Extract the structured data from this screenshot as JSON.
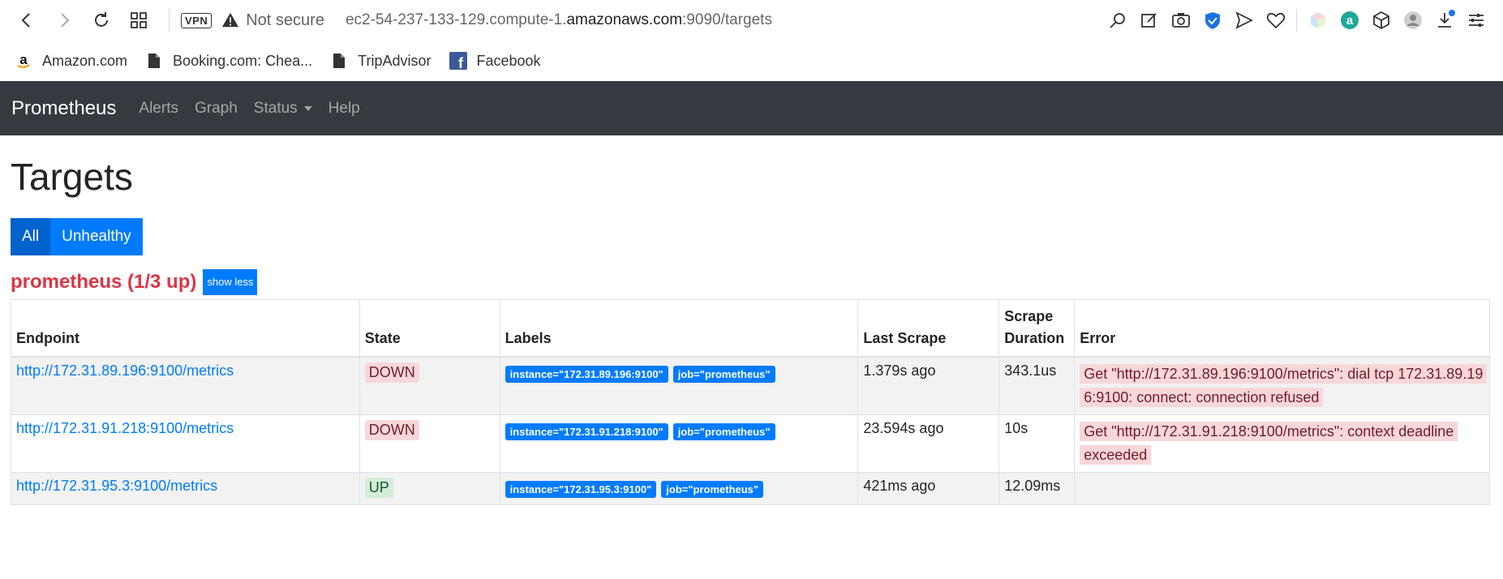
{
  "browser": {
    "vpn_label": "VPN",
    "security_text": "Not secure",
    "url_prefix": "ec2-54-237-133-129.compute-1.",
    "url_domain": "amazonaws.com",
    "url_suffix": ":9090/targets"
  },
  "bookmarks": [
    {
      "label": "Amazon.com",
      "icon": "amazon-icon"
    },
    {
      "label": "Booking.com: Chea...",
      "icon": "page-icon"
    },
    {
      "label": "TripAdvisor",
      "icon": "page-icon"
    },
    {
      "label": "Facebook",
      "icon": "facebook-icon"
    }
  ],
  "navbar": {
    "brand": "Prometheus",
    "links": [
      "Alerts",
      "Graph",
      "Status",
      "Help"
    ]
  },
  "page": {
    "title": "Targets",
    "filter_all": "All",
    "filter_unhealthy": "Unhealthy",
    "job_title": "prometheus (1/3 up)",
    "show_less": "show less"
  },
  "table": {
    "headers": [
      "Endpoint",
      "State",
      "Labels",
      "Last Scrape",
      "Scrape Duration",
      "Error"
    ],
    "rows": [
      {
        "endpoint": "http://172.31.89.196:9100/metrics",
        "state": "DOWN",
        "label_instance": "instance=\"172.31.89.196:9100\"",
        "label_job": "job=\"prometheus\"",
        "last_scrape": "1.379s ago",
        "duration": "343.1us",
        "error": "Get \"http://172.31.89.196:9100/metrics\": dial tcp 172.31.89.196:9100: connect: connection refused"
      },
      {
        "endpoint": "http://172.31.91.218:9100/metrics",
        "state": "DOWN",
        "label_instance": "instance=\"172.31.91.218:9100\"",
        "label_job": "job=\"prometheus\"",
        "last_scrape": "23.594s ago",
        "duration": "10s",
        "error": "Get \"http://172.31.91.218:9100/metrics\": context deadline exceeded"
      },
      {
        "endpoint": "http://172.31.95.3:9100/metrics",
        "state": "UP",
        "label_instance": "instance=\"172.31.95.3:9100\"",
        "label_job": "job=\"prometheus\"",
        "last_scrape": "421ms ago",
        "duration": "12.09ms",
        "error": ""
      }
    ]
  }
}
